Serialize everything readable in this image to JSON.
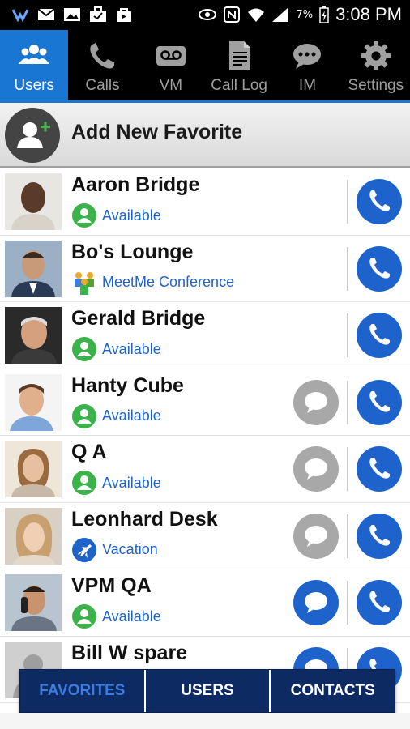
{
  "status_bar": {
    "time": "3:08 PM",
    "battery": "7%"
  },
  "tabs": [
    {
      "label": "Users",
      "icon": "users-icon",
      "active": true
    },
    {
      "label": "Calls",
      "icon": "phone-icon",
      "active": false
    },
    {
      "label": "VM",
      "icon": "voicemail-icon",
      "active": false
    },
    {
      "label": "Call Log",
      "icon": "call-log-icon",
      "active": false
    },
    {
      "label": "IM",
      "icon": "chat-icon",
      "active": false
    },
    {
      "label": "Settings",
      "icon": "gear-icon",
      "active": false
    }
  ],
  "add_favorite": {
    "label": "Add New Favorite"
  },
  "users": [
    {
      "name": "Aaron Bridge",
      "status": "Available",
      "status_icon": "available-icon",
      "has_im": false,
      "im_active": false
    },
    {
      "name": "Bo's Lounge",
      "status": "MeetMe Conference",
      "status_icon": "conference-icon",
      "has_im": false,
      "im_active": false
    },
    {
      "name": "Gerald Bridge",
      "status": "Available",
      "status_icon": "available-icon",
      "has_im": false,
      "im_active": false
    },
    {
      "name": "Hanty Cube",
      "status": "Available",
      "status_icon": "available-icon",
      "has_im": true,
      "im_active": false
    },
    {
      "name": "Q A",
      "status": "Available",
      "status_icon": "available-icon",
      "has_im": true,
      "im_active": false
    },
    {
      "name": "Leonhard Desk",
      "status": "Vacation",
      "status_icon": "vacation-icon",
      "has_im": true,
      "im_active": false
    },
    {
      "name": "VPM QA",
      "status": "Available",
      "status_icon": "available-icon",
      "has_im": true,
      "im_active": true
    },
    {
      "name": "Bill W spare",
      "status": "",
      "status_icon": "",
      "has_im": true,
      "im_active": true
    }
  ],
  "bottom_tabs": [
    {
      "label": "FAVORITES",
      "active": true
    },
    {
      "label": "USERS",
      "active": false
    },
    {
      "label": "CONTACTS",
      "active": false
    }
  ],
  "colors": {
    "accent": "#1976d2",
    "call_button": "#1e63cc",
    "im_inactive": "#a8a8a8",
    "available": "#3cb34a",
    "status_text": "#1f63c7",
    "bottom_bar": "#0e2a63"
  }
}
